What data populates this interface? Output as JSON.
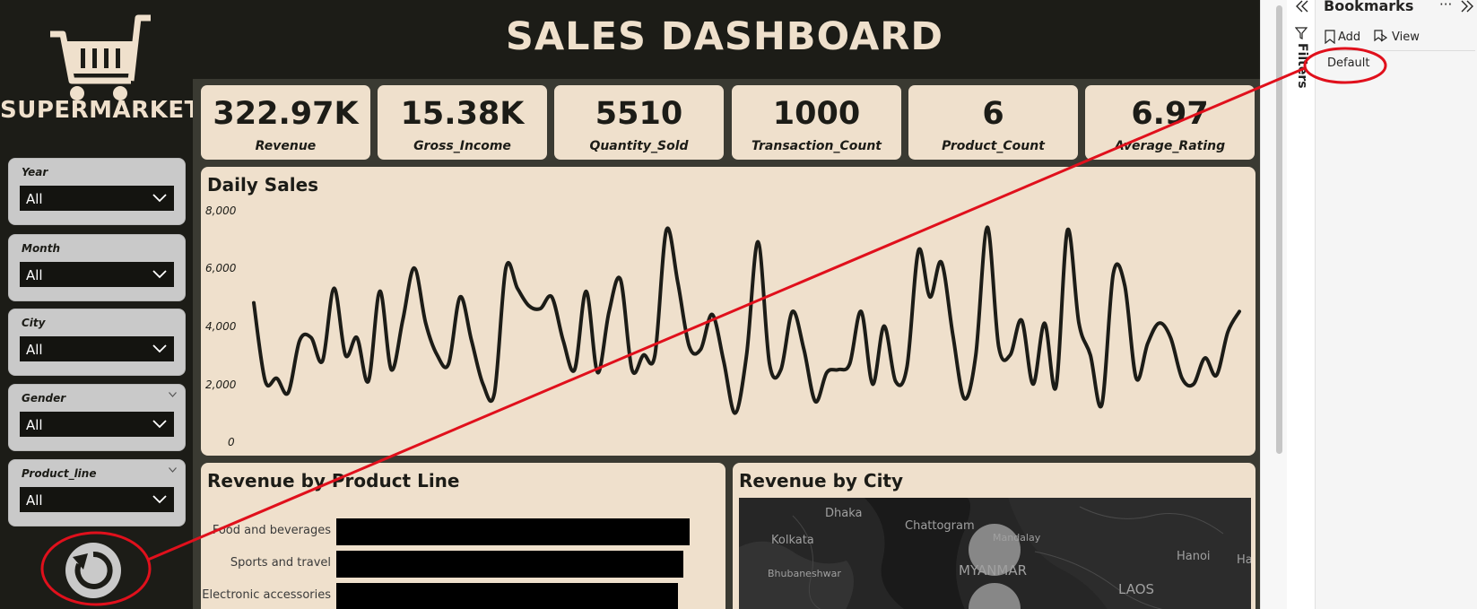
{
  "brand": "SUPERMARKET",
  "title": "SALES DASHBOARD",
  "slicers": [
    {
      "label": "Year",
      "value": "All"
    },
    {
      "label": "Month",
      "value": "All"
    },
    {
      "label": "City",
      "value": "All"
    },
    {
      "label": "Gender",
      "value": "All"
    },
    {
      "label": "Product_line",
      "value": "All"
    }
  ],
  "kpis": [
    {
      "value": "322.97K",
      "label": "Revenue"
    },
    {
      "value": "15.38K",
      "label": "Gross_Income"
    },
    {
      "value": "5510",
      "label": "Quantity_Sold"
    },
    {
      "value": "1000",
      "label": "Transaction_Count"
    },
    {
      "value": "6",
      "label": "Product_Count"
    },
    {
      "value": "6.97",
      "label": "Average_Rating"
    }
  ],
  "daily_sales": {
    "title": "Daily Sales",
    "y_ticks": [
      "8,000",
      "6,000",
      "4,000",
      "2,000",
      "0"
    ],
    "ylim": [
      0,
      8000
    ],
    "values": [
      4800,
      2100,
      2200,
      1700,
      3500,
      3600,
      2800,
      5300,
      3000,
      3600,
      2100,
      5200,
      2500,
      4200,
      6000,
      4100,
      3000,
      2700,
      5000,
      3500,
      2000,
      1700,
      6000,
      5300,
      4700,
      4600,
      5000,
      3500,
      2500,
      5200,
      2400,
      4500,
      5600,
      2500,
      3000,
      3000,
      7300,
      5500,
      3300,
      3200,
      4400,
      2800,
      1000,
      3000,
      6900,
      2700,
      2500,
      4500,
      3200,
      1400,
      2400,
      2500,
      2700,
      4500,
      2000,
      4000,
      2100,
      2600,
      6600,
      5000,
      6200,
      3700,
      1500,
      3000,
      7400,
      3300,
      3000,
      4200,
      2000,
      4100,
      1900,
      7300,
      4100,
      3000,
      1300,
      5800,
      5400,
      2200,
      3400,
      4100,
      3600,
      2200,
      2000,
      2900,
      2300,
      3800,
      4500
    ]
  },
  "revenue_by_product_line": {
    "title": "Revenue by Product Line",
    "categories": [
      "Food and beverages",
      "Sports and travel",
      "Electronic accessories"
    ],
    "values": [
      56144.8,
      55122.8,
      54337.5
    ],
    "xlim": [
      0,
      57000
    ]
  },
  "revenue_by_city": {
    "title": "Revenue by City",
    "labels": [
      "Dhaka",
      "Chattogram",
      "Kolkata",
      "Mandalay",
      "MYANMAR",
      "Bhubaneshwar",
      "Hanoi",
      "LAOS",
      "Ha"
    ]
  },
  "pane": {
    "filters_label": "Filters",
    "bookmarks_title": "Bookmarks",
    "more": "···",
    "add_label": "Add",
    "view_label": "View",
    "default_bookmark": "Default"
  },
  "colors": {
    "canvas": "#1c1c17",
    "card": "#efe0cc",
    "annotation": "#e0101c"
  }
}
